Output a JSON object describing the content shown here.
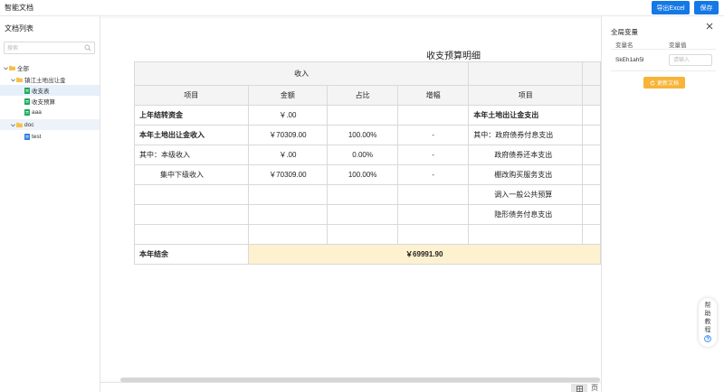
{
  "app": {
    "title": "智能文档"
  },
  "toolbar": {
    "export_label": "导出Excel",
    "save_label": "保存"
  },
  "sidebar": {
    "title": "文档列表",
    "search_placeholder": "搜索",
    "tree": {
      "root": "全部",
      "folder1": "镇江土地出让金",
      "item_a": "收支表",
      "item_b": "收支预算",
      "item_c": "aaa",
      "folder2": "doc",
      "item_d": "test"
    }
  },
  "doc": {
    "title": "收支预算明细",
    "income_header": "收入",
    "col_headers": [
      "项目",
      "金额",
      "占比",
      "增幅",
      "项目"
    ],
    "rows": [
      {
        "item": "上年结转资金",
        "amount": "￥.00",
        "ratio": "",
        "growth": "",
        "exp_item": "本年土地出让金支出"
      },
      {
        "item": "本年土地出让金收入",
        "amount": "￥70309.00",
        "ratio": "100.00%",
        "growth": "-",
        "exp_item": "其中：政府债券付息支出"
      },
      {
        "item": "其中：本级收入",
        "amount": "￥.00",
        "ratio": "0.00%",
        "growth": "-",
        "exp_item": "政府债券还本支出"
      },
      {
        "item": "集中下级收入",
        "amount": "￥70309.00",
        "ratio": "100.00%",
        "growth": "-",
        "exp_item": "棚改购买服务支出"
      },
      {
        "item": "",
        "amount": "",
        "ratio": "",
        "growth": "",
        "exp_item": "调入一般公共预算"
      },
      {
        "item": "",
        "amount": "",
        "ratio": "",
        "growth": "",
        "exp_item": "隐形债务付息支出"
      },
      {
        "item": "",
        "amount": "",
        "ratio": "",
        "growth": "",
        "exp_item": ""
      }
    ],
    "footer_label": "本年结余",
    "footer_value": "￥69991.90"
  },
  "bottom": {
    "page_view_label": "页"
  },
  "right_panel": {
    "title": "全局变量",
    "col_name": "变量名",
    "col_value": "变量值",
    "var_name": "SkEh1ah5l",
    "value_placeholder": "请输入",
    "update_label": "更新文档"
  },
  "help": {
    "label": "帮助教程"
  },
  "colors": {
    "primary": "#1478e6",
    "accent": "#f7b437",
    "income_red": "#e0312a",
    "balance_bg": "#fdf1cf"
  }
}
